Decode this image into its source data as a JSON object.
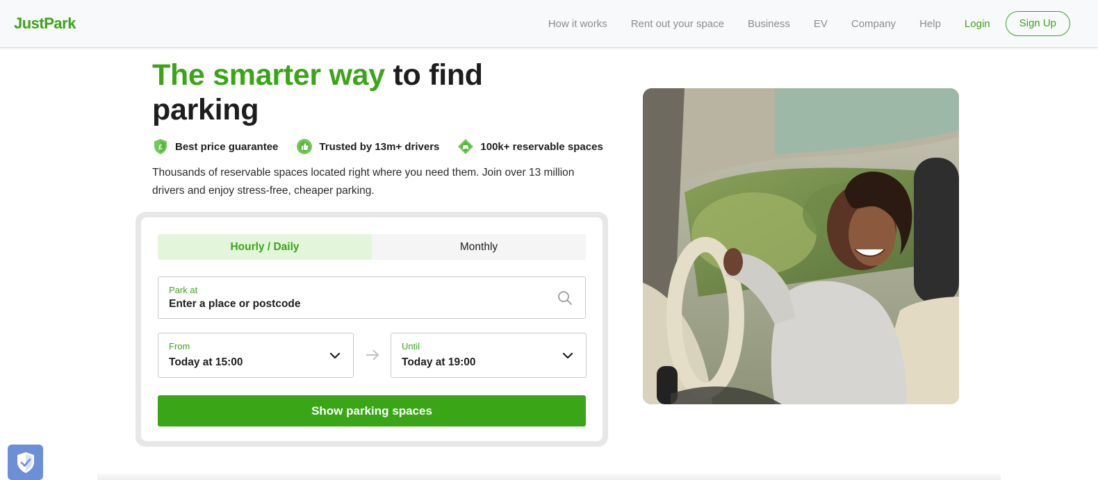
{
  "header": {
    "logo": "JustPark",
    "nav": [
      "How it works",
      "Rent out your space",
      "Business",
      "EV",
      "Company",
      "Help"
    ],
    "login": "Login",
    "signup": "Sign Up"
  },
  "hero": {
    "title_green": "The smarter way",
    "title_rest": " to find parking",
    "features": [
      {
        "label": "Best price guarantee",
        "icon": "pound-shield-icon"
      },
      {
        "label": "Trusted by 13m+ drivers",
        "icon": "thumbs-up-icon"
      },
      {
        "label": "100k+ reservable spaces",
        "icon": "car-icon"
      }
    ],
    "subtitle": "Thousands of reservable spaces located right where you need them. Join over 13 million drivers and enjoy stress-free, cheaper parking."
  },
  "search": {
    "tabs": [
      "Hourly / Daily",
      "Monthly"
    ],
    "active_tab": "Hourly / Daily",
    "park_label": "Park at",
    "park_placeholder": "Enter a place or postcode",
    "from_label": "From",
    "from_value": "Today at 15:00",
    "until_label": "Until",
    "until_value": "Today at 19:00",
    "button": "Show parking spaces"
  },
  "colors": {
    "brand_green": "#3aa517",
    "active_tab_bg": "#e3f6dc"
  }
}
